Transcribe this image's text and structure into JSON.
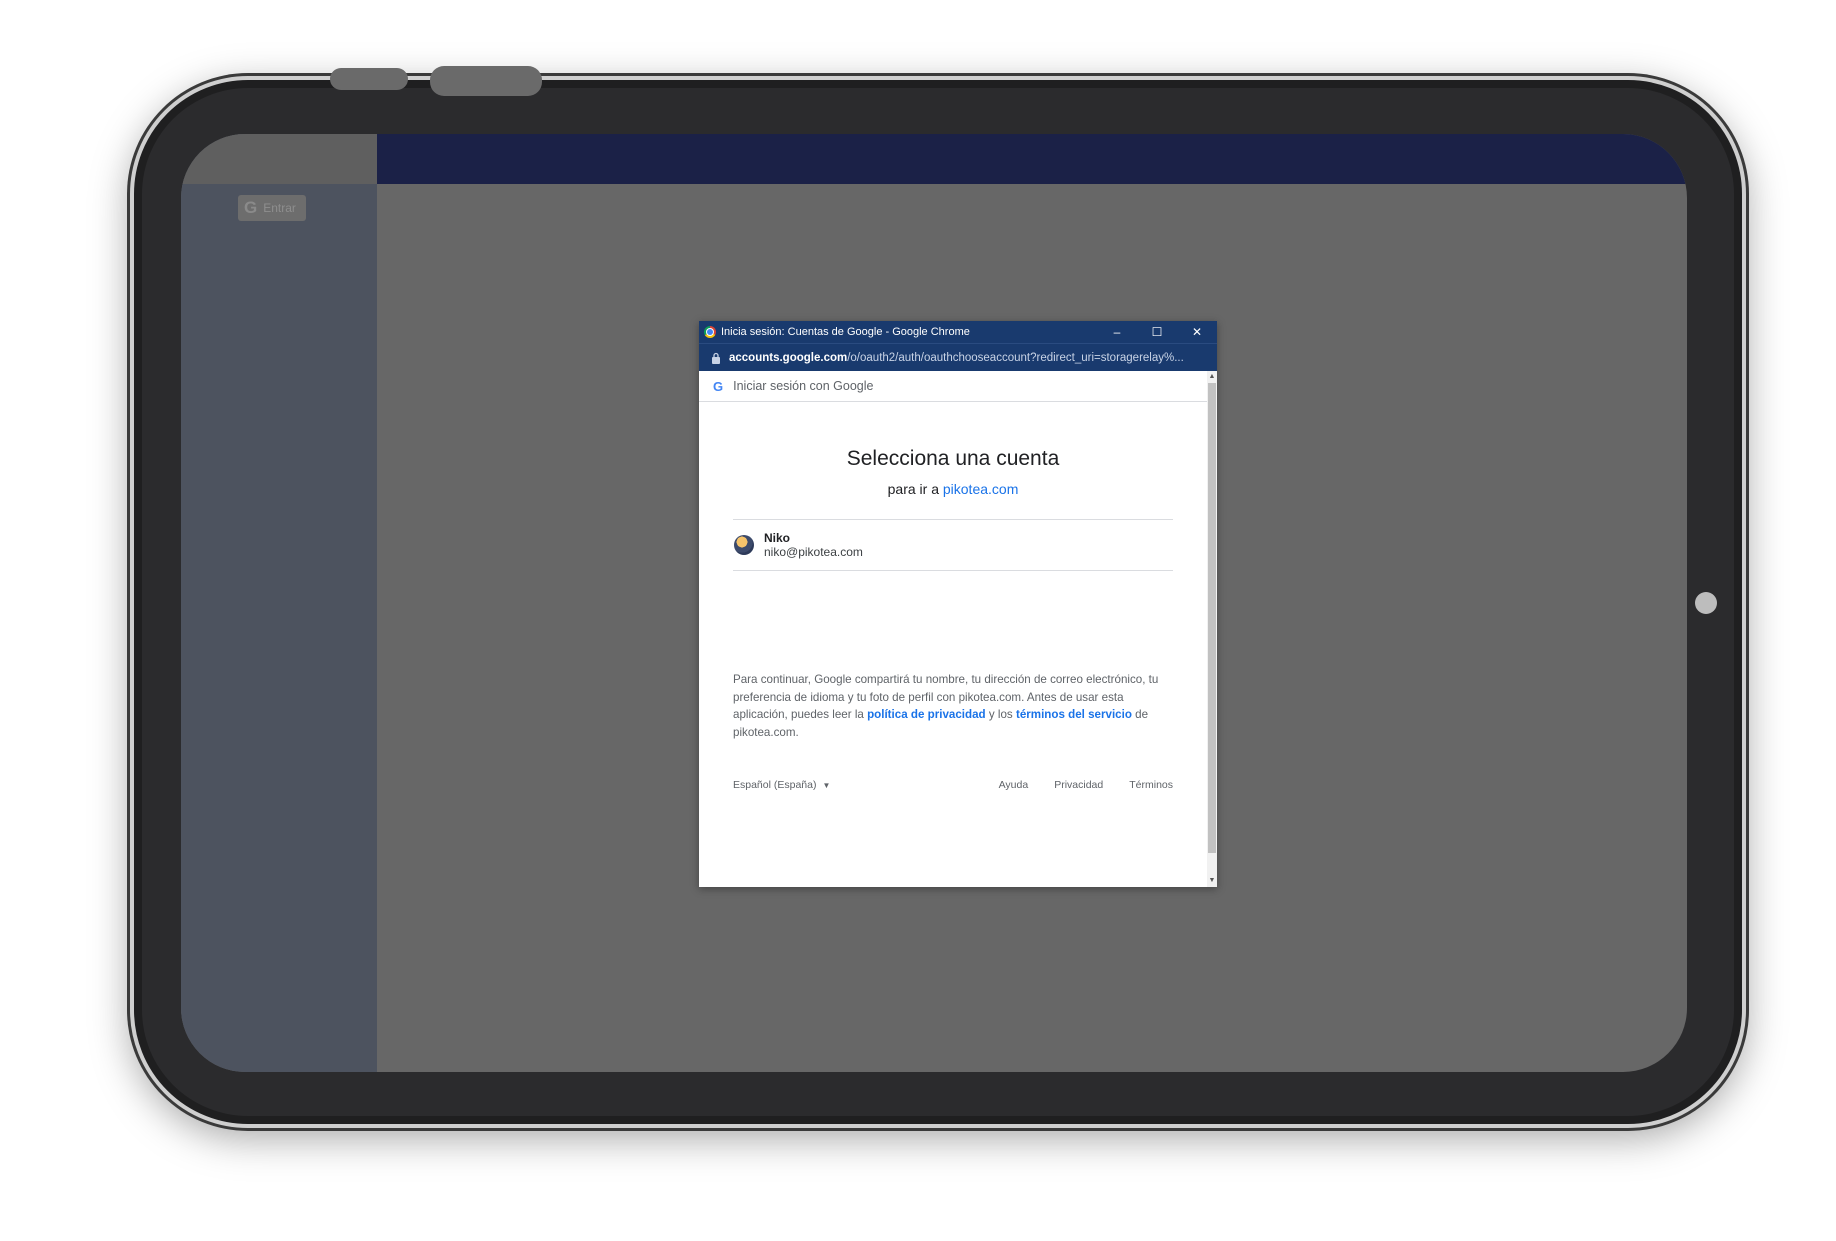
{
  "background_app": {
    "entrar_label": "Entrar"
  },
  "window": {
    "title": "Inicia sesión: Cuentas de Google - Google Chrome",
    "minimize": "–",
    "maximize": "☐",
    "close": "✕"
  },
  "url": {
    "host": "accounts.google.com",
    "path": "/o/oauth2/auth/oauthchooseaccount?redirect_uri=storagerelay%..."
  },
  "signin": {
    "header": "Iniciar sesión con Google",
    "title": "Selecciona una cuenta",
    "subtitle_prefix": "para ir a",
    "subtitle_link": "pikotea.com"
  },
  "account": {
    "name": "Niko",
    "email": "niko@pikotea.com"
  },
  "consent": {
    "part1": "Para continuar, Google compartirá tu nombre, tu dirección de correo electrónico, tu preferencia de idioma y tu foto de perfil con pikotea.com. Antes de usar esta aplicación, puedes leer la",
    "privacy_link": "política de privacidad",
    "part2": "y los",
    "terms_link": "términos del servicio",
    "part3": "de pikotea.com."
  },
  "footer": {
    "language": "Español (España)",
    "help": "Ayuda",
    "privacy": "Privacidad",
    "terms": "Términos"
  },
  "colors": {
    "titlebar": "#193a6e",
    "link": "#1a73e8",
    "topbar": "#1b2147"
  }
}
